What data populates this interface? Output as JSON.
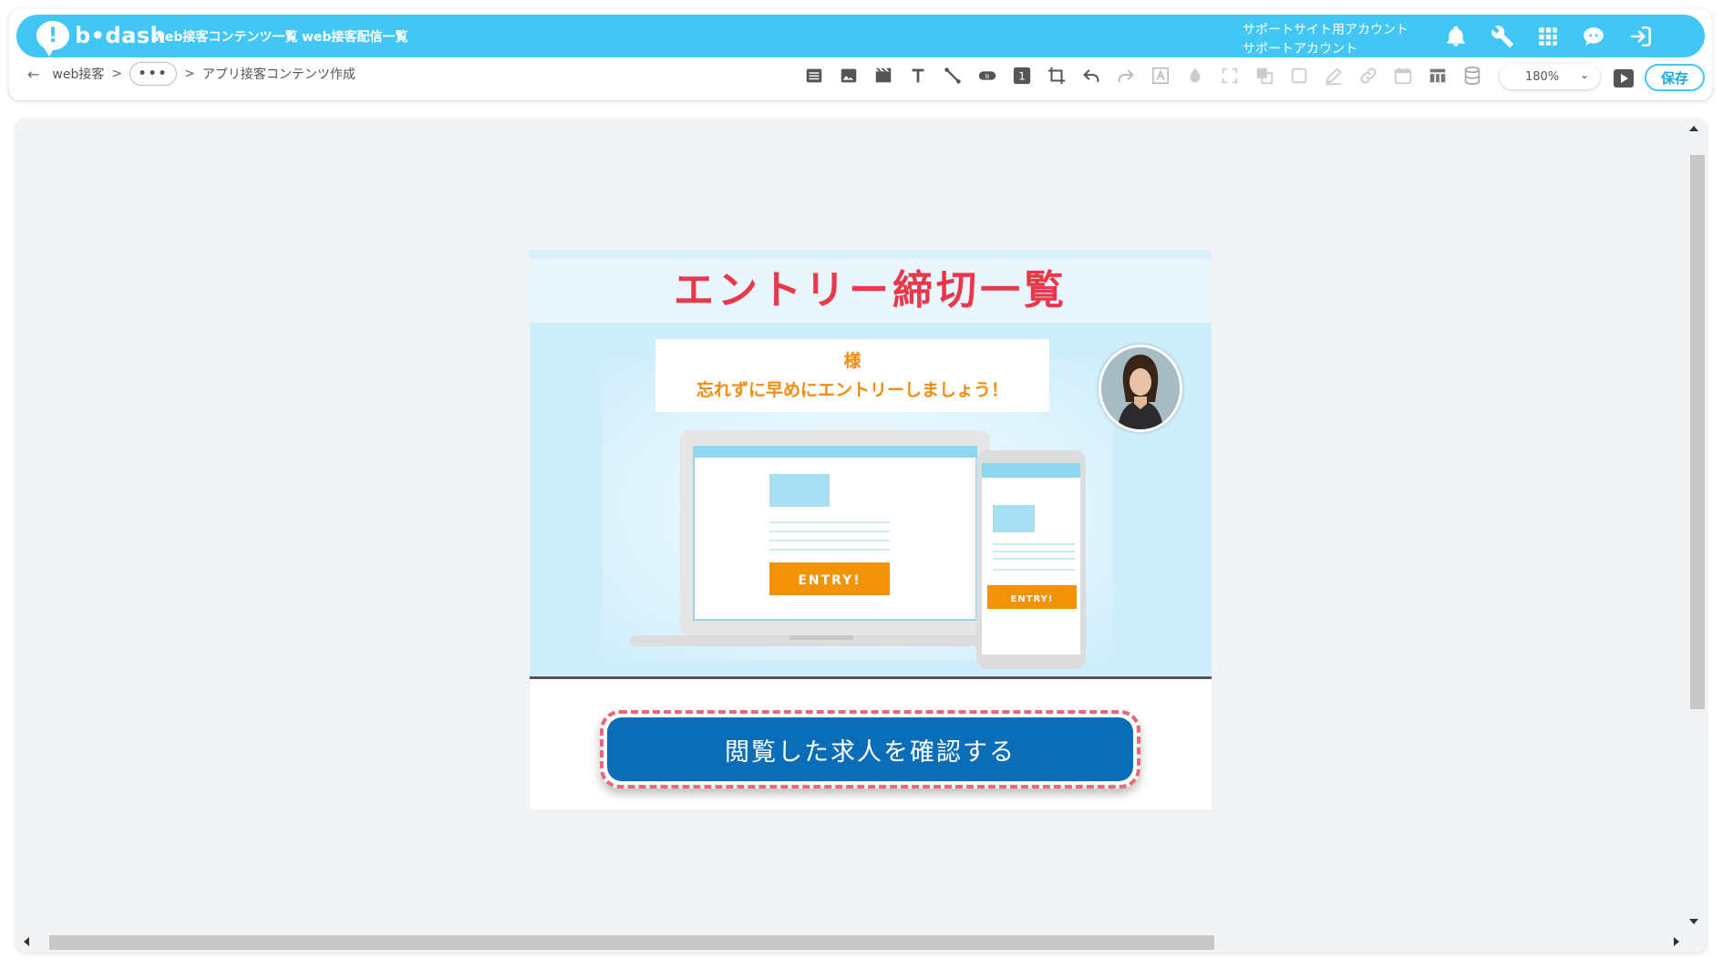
{
  "app": {
    "logo_text": "b•dash",
    "nav": [
      "web接客コンテンツ一覧",
      "web接客配信一覧"
    ],
    "account_line1": "サポートサイト用アカウント",
    "account_line2": "サポートアカウント"
  },
  "breadcrumb": {
    "back": "←",
    "root": "web接客",
    "sep": ">",
    "more": "•••",
    "current": "アプリ接客コンテンツ作成"
  },
  "toolbar": {
    "zoom": "180%",
    "save_label": "保存",
    "icons": [
      "list-icon",
      "image-icon",
      "video-icon",
      "text-icon",
      "line-icon",
      "button-icon",
      "number-icon",
      "crop-icon",
      "undo-icon",
      "redo-icon",
      "text-frame-icon",
      "color-drop-icon",
      "expand-icon",
      "layers-icon",
      "square-icon",
      "pen-icon",
      "link-icon",
      "calendar-icon",
      "table-icon",
      "database-icon"
    ]
  },
  "content": {
    "title": "エントリー締切一覧",
    "message_line1": "様",
    "message_line2": "忘れずに早めにエントリーしましょう！",
    "entry_label": "ENTRY!",
    "cta_label": "閲覧した求人を確認する"
  },
  "colors": {
    "brand": "#42c6f5",
    "title_red": "#e8384a",
    "message_orange": "#f28c0f",
    "cta_blue": "#0a6db8",
    "cta_border": "#e8677a"
  }
}
